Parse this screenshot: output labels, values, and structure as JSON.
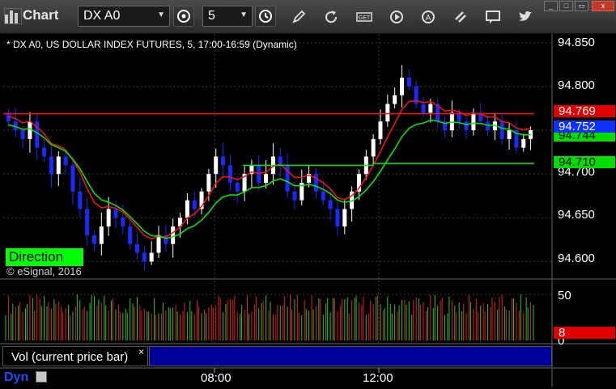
{
  "window": {
    "title": "Chart",
    "controls": [
      "_",
      "□",
      "▭",
      "x"
    ]
  },
  "toolbar": {
    "symbol_value": "DX A0",
    "interval_value": "5",
    "icons": [
      "settings-icon",
      "clock-icon",
      "pencil-icon",
      "refresh-icon",
      "get-icon",
      "play-icon",
      "alert-icon",
      "link-icon",
      "chat-icon",
      "twitter-icon"
    ]
  },
  "chart": {
    "info": "* DX A0, US DOLLAR INDEX FUTURES, 5, 17:00-16:59 (Dynamic)",
    "direction_label": "Direction",
    "copyright": "© eSignal, 2016",
    "price_ticks": [
      "94.850",
      "94.800",
      "94.750",
      "94.700",
      "94.650",
      "94.600"
    ],
    "tags": [
      {
        "text": "94.769",
        "bg": "#e00000",
        "fg": "#ffffff"
      },
      {
        "text": "94.752",
        "bg": "#1030ff",
        "fg": "#ffffff"
      },
      {
        "text": "94.744",
        "bg": "#00dd00",
        "fg": "#000000"
      },
      {
        "text": "94.710",
        "bg": "#00dd00",
        "fg": "#000000"
      }
    ],
    "colors": {
      "up_bar": "#ffffff",
      "down_bar": "#1a2aff",
      "red_line": "#ff1010",
      "green_line": "#00ee00",
      "grid": "#3a3a3a"
    }
  },
  "volume": {
    "title": "Vol (current price bar)",
    "close_symbol": "×",
    "ticks": [
      "50",
      "0"
    ],
    "current_tag": "8"
  },
  "footer": {
    "mode": "Dyn",
    "times": [
      "08:00",
      "12:00"
    ]
  },
  "chart_data": {
    "type": "candlestick",
    "ylim": [
      94.58,
      94.86
    ],
    "y_ticks": [
      94.6,
      94.65,
      94.7,
      94.75,
      94.8,
      94.85
    ],
    "x_ticks": [
      "08:00",
      "12:00"
    ],
    "series": [
      {
        "name": "price",
        "last": 94.752
      },
      {
        "name": "red_line",
        "last": 94.769
      },
      {
        "name": "green_line",
        "last": 94.744
      },
      {
        "name": "green_level",
        "value": 94.71
      }
    ],
    "closes": [
      94.76,
      94.75,
      94.74,
      94.76,
      94.73,
      94.72,
      94.7,
      94.72,
      94.71,
      94.68,
      94.66,
      94.63,
      94.62,
      94.64,
      94.66,
      94.65,
      94.64,
      94.62,
      94.61,
      94.6,
      94.61,
      94.63,
      94.62,
      94.64,
      94.65,
      94.67,
      94.66,
      94.68,
      94.7,
      94.72,
      94.71,
      94.69,
      94.68,
      94.7,
      94.71,
      94.69,
      94.7,
      94.72,
      94.71,
      94.68,
      94.67,
      94.69,
      94.7,
      94.68,
      94.67,
      94.66,
      94.64,
      94.66,
      94.68,
      94.7,
      94.72,
      94.74,
      94.76,
      94.78,
      94.79,
      94.81,
      94.8,
      94.78,
      94.77,
      94.78,
      94.76,
      94.75,
      94.77,
      94.76,
      94.75,
      94.77,
      94.76,
      94.75,
      94.76,
      94.74,
      94.75,
      94.73,
      94.74,
      94.75
    ],
    "volume_max": 60
  }
}
